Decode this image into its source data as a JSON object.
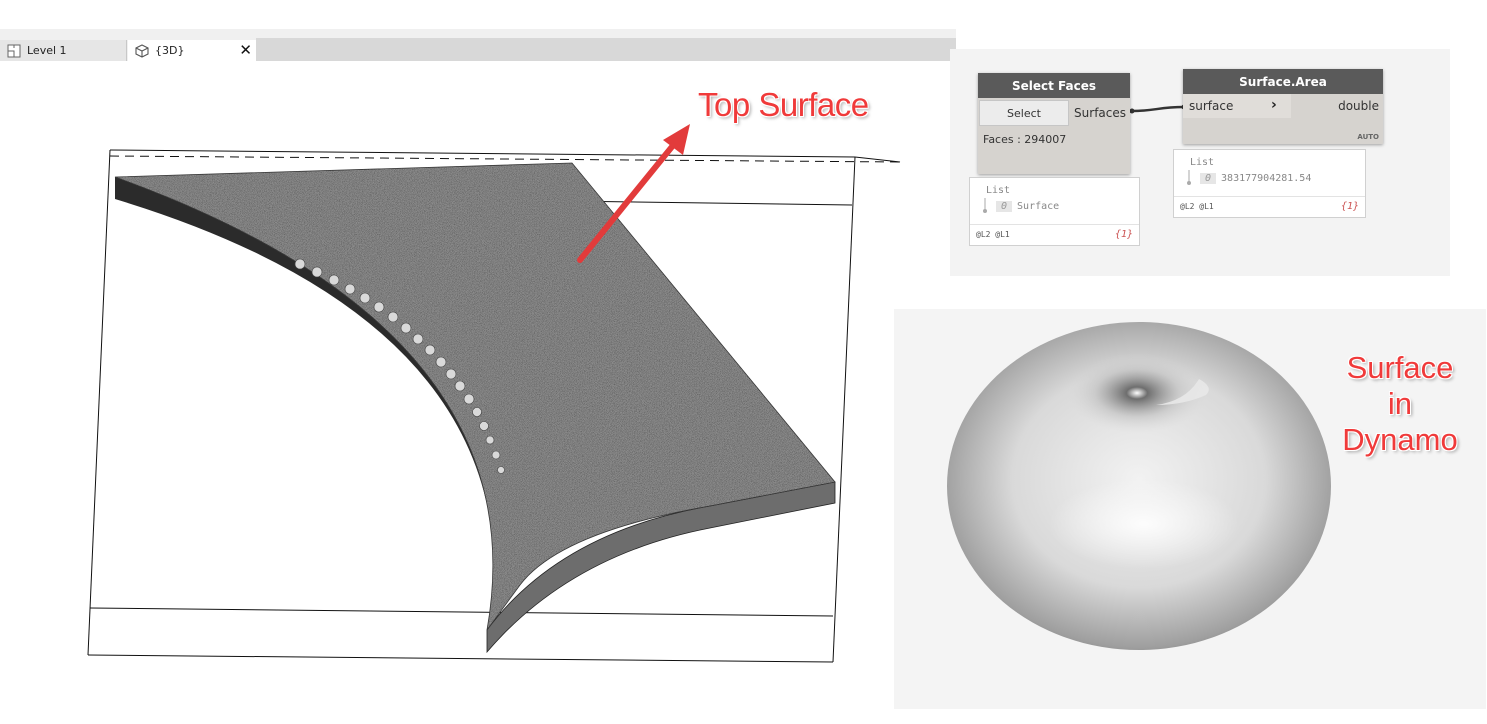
{
  "tabs": [
    {
      "label": "Level 1"
    },
    {
      "label": "{3D}"
    }
  ],
  "tab_close": "✕",
  "annotations": {
    "top_surface": "Top Surface",
    "surface_in_dynamo": [
      "Surface",
      "in",
      "Dynamo"
    ]
  },
  "colors": {
    "annotation_red": "#f03a3a",
    "node_title_bg": "#5a5a5a",
    "node_body_bg": "#d6d3cf"
  },
  "dynamo": {
    "select_faces": {
      "title": "Select Faces",
      "button": "Select",
      "output": "Surfaces",
      "status": "Faces : 294007",
      "preview": {
        "list_label": "List",
        "index": "0",
        "value": "Surface",
        "levels": "@L2 @L1",
        "count": "{1}"
      }
    },
    "surface_area": {
      "title": "Surface.Area",
      "input": "surface",
      "output": "double",
      "lacing": "AUTO",
      "preview": {
        "list_label": "List",
        "index": "0",
        "value": "383177904281.54",
        "levels": "@L2 @L1",
        "count": "{1}"
      }
    }
  }
}
